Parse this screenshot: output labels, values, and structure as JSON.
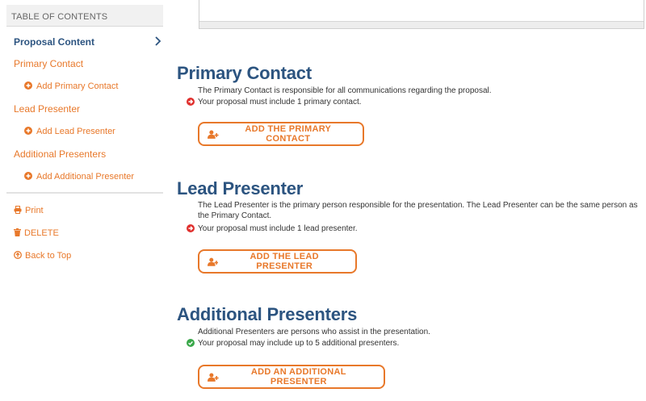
{
  "sidebar": {
    "header": "TABLE OF CONTENTS",
    "items": [
      {
        "label": "Proposal Content"
      },
      {
        "label": "Primary Contact"
      },
      {
        "label": "Add Primary Contact"
      },
      {
        "label": "Lead Presenter"
      },
      {
        "label": "Add Lead Presenter"
      },
      {
        "label": "Additional Presenters"
      },
      {
        "label": "Add Additional Presenter"
      }
    ],
    "utilities": [
      {
        "label": "Print",
        "icon": "print-icon"
      },
      {
        "label": "DELETE",
        "icon": "trash-icon"
      },
      {
        "label": "Back to Top",
        "icon": "arrow-up-circle-icon"
      }
    ]
  },
  "sections": {
    "primary_contact": {
      "title": "Primary Contact",
      "description": "The Primary Contact is responsible for all communications regarding the proposal.",
      "requirement": "Your proposal must include 1 primary contact.",
      "requirement_status": "error",
      "button": "ADD THE PRIMARY CONTACT"
    },
    "lead_presenter": {
      "title": "Lead Presenter",
      "description": "The Lead Presenter is the primary person responsible for the presentation. The Lead Presenter can be the same person as the Primary Contact.",
      "requirement": "Your proposal must include 1 lead presenter.",
      "requirement_status": "error",
      "button": "ADD THE LEAD PRESENTER"
    },
    "additional_presenters": {
      "title": "Additional Presenters",
      "description": "Additional Presenters are persons who assist in the presentation.",
      "requirement": "Your proposal may include up to 5 additional presenters.",
      "requirement_status": "ok",
      "button": "ADD AN ADDITIONAL PRESENTER"
    }
  },
  "colors": {
    "accent": "#e8782a",
    "heading": "#2c5480",
    "error": "#e0312f",
    "success": "#3aa84a"
  }
}
